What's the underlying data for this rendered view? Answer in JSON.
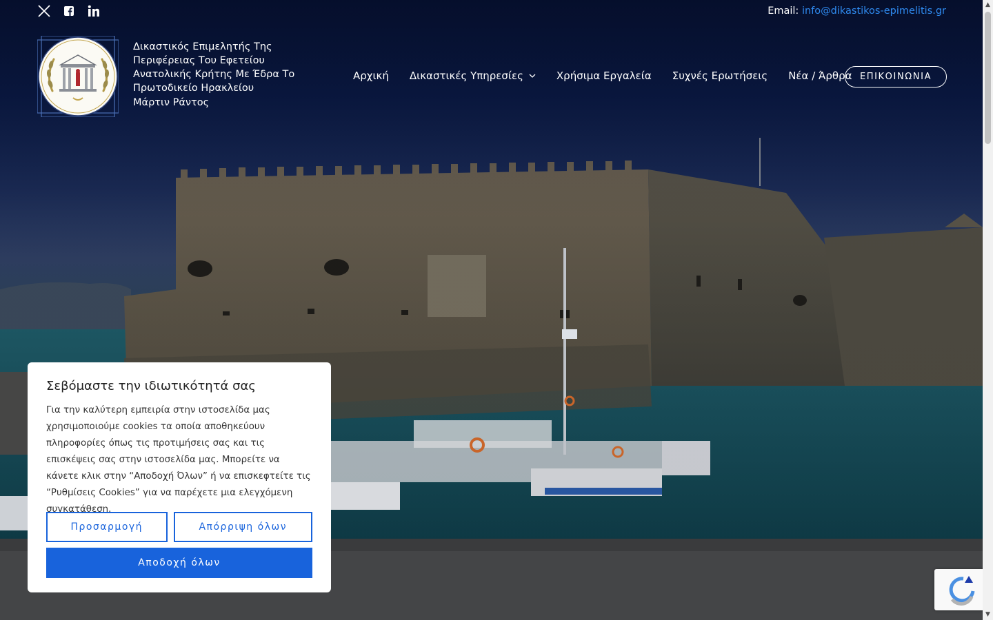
{
  "topbar": {
    "social": [
      {
        "name": "x-twitter-icon"
      },
      {
        "name": "facebook-icon"
      },
      {
        "name": "linkedin-icon"
      }
    ],
    "email_label": "Email:",
    "email_value": "info@dikastikos-epimelitis.gr"
  },
  "header": {
    "site_title": "Δικαστικός Επιμελητής Της Περιφέρειας Του Εφετείου Ανατολικής Κρήτης Με Έδρα Το Πρωτοδικείο Ηρακλείου",
    "site_subtitle": "Μάρτιν Ράντος",
    "nav": [
      {
        "label": "Αρχική"
      },
      {
        "label": "Δικαστικές Υπηρεσίες",
        "has_dropdown": true
      },
      {
        "label": "Χρήσιμα Εργαλεία"
      },
      {
        "label": "Συχνές Ερωτήσεις"
      },
      {
        "label": "Νέα / Άρθρα"
      }
    ],
    "contact_button": "ΕΠΙΚΟΙΝΩΝΙΑ"
  },
  "cookie_banner": {
    "title": "Σεβόμαστε την ιδιωτικότητά σας",
    "body": "Για την καλύτερη εμπειρία στην ιστοσελίδα μας χρησιμοποιούμε cookies τα οποία αποθηκεύουν πληροφορίες όπως τις προτιμήσεις σας και τις επισκέψεις σας στην ιστοσελίδα μας. Μπορείτε να κάνετε κλικ στην “Αποδοχή Όλων” ή να επισκεφτείτε τις “Ρυθμίσεις Cookies” για να παρέχετε μια ελεγχόμενη συγκατάθεση.",
    "customize_button": "Προσαρμογή",
    "reject_button": "Απόρριψη όλων",
    "accept_button": "Αποδοχή όλων"
  },
  "colors": {
    "accent": "#1863dc",
    "link": "#2f8bf0",
    "hero_top": "#061131"
  }
}
